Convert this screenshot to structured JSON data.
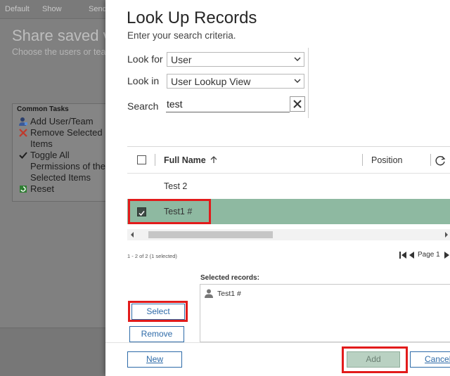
{
  "background": {
    "toolbar": [
      "Default",
      "Show",
      "Send"
    ],
    "title": "Share saved v",
    "subtitle": "Choose the users or tea",
    "common_tasks": {
      "header": "Common Tasks",
      "items": [
        {
          "label": "Add User/Team",
          "icon": "add-user-icon"
        },
        {
          "label": "Remove Selected Items",
          "icon": "remove-x-icon"
        },
        {
          "label": "Toggle All Permissions of the Selected Items",
          "icon": "checkmark-icon"
        },
        {
          "label": "Reset",
          "icon": "reset-icon"
        }
      ]
    }
  },
  "dialog": {
    "title": "Look Up Records",
    "subtitle": "Enter your search criteria.",
    "look_for_label": "Look for",
    "look_for_value": "User",
    "look_in_label": "Look in",
    "look_in_value": "User Lookup View",
    "search_label": "Search",
    "search_value": "test"
  },
  "grid": {
    "columns": [
      "Full Name",
      "Position"
    ],
    "rows": [
      {
        "full_name": "Test 2",
        "selected": false
      },
      {
        "full_name": "Test1 #",
        "selected": true
      }
    ],
    "count_text": "1 - 2 of 2 (1 selected)",
    "page_label": "Page 1"
  },
  "selected_records": {
    "label": "Selected records:",
    "items": [
      "Test1 #"
    ]
  },
  "buttons": {
    "select": "Select",
    "remove": "Remove",
    "new": "New",
    "add": "Add",
    "cancel": "Cancel"
  },
  "colors": {
    "selected_row": "#8eb9a1",
    "highlight": "#e21b1b",
    "link_blue": "#2d6aa8"
  }
}
